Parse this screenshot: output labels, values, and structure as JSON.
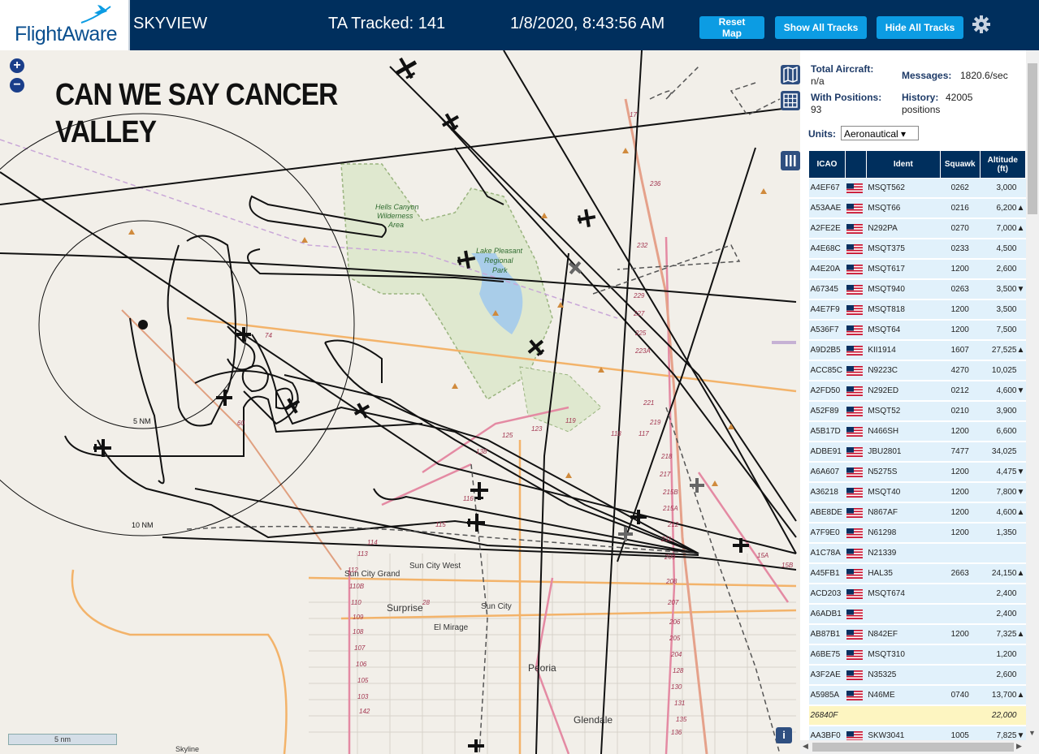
{
  "header": {
    "logo_text": "FlightAware",
    "app_title": "SKYVIEW",
    "tracked_label": "TA Tracked: 141",
    "datetime": "1/8/2020, 8:43:56 AM",
    "buttons": {
      "reset": "Reset Map",
      "show_all": "Show All Tracks",
      "hide_all": "Hide All Tracks"
    },
    "accent_color": "#0c9ce3",
    "bar_color": "#002f5d",
    "icons": [
      "gear-icon",
      "logo-plane-icon"
    ]
  },
  "map": {
    "overlay_line1": "CAN WE SAY CANCER",
    "overlay_line2": "VALLEY",
    "zoom_in": "+",
    "zoom_out": "−",
    "scale_label": "5 nm",
    "info_label": "i",
    "range_rings": [
      "5 NM",
      "10 NM"
    ],
    "places": [
      "Hells Canyon",
      "Wilderness",
      "Area",
      "Lake Pleasant",
      "Regional",
      "Park",
      "Sun City West",
      "Sun City Grand",
      "Surprise",
      "Sun City",
      "El Mirage",
      "Peoria",
      "Glendale",
      "Skyline"
    ],
    "road_labels": [
      "17",
      "74",
      "60",
      "236",
      "232",
      "229",
      "227",
      "225",
      "223A",
      "221",
      "219",
      "218",
      "217",
      "215B",
      "215A",
      "212",
      "211",
      "209",
      "208",
      "207",
      "206",
      "205",
      "204",
      "128",
      "130",
      "131",
      "135",
      "136",
      "138",
      "125",
      "123",
      "119",
      "118",
      "117",
      "116",
      "115",
      "114",
      "113",
      "112",
      "110B",
      "110",
      "109",
      "108",
      "107",
      "106",
      "105",
      "103",
      "142",
      "28",
      "15A",
      "15B"
    ],
    "tools": [
      "map-layers-icon",
      "grid-icon",
      "columns-icon"
    ]
  },
  "panel": {
    "total_aircraft_label": "Total Aircraft:",
    "total_aircraft_value": "n/a",
    "messages_label": "Messages:",
    "messages_value": "1820.6/sec",
    "with_positions_label": "With Positions:",
    "with_positions_value": "93",
    "history_label": "History:",
    "history_value": "42005",
    "history_unit": "positions",
    "units_label": "Units:",
    "units_value": "Aeronautical ▾",
    "columns": {
      "icao": "ICAO",
      "ident": "Ident",
      "squawk": "Squawk",
      "altitude": "Altitude (ft)"
    },
    "rows": [
      {
        "icao": "A4EF67",
        "ident": "MSQT562",
        "squawk": "0262",
        "alt": "3,000",
        "trend": ""
      },
      {
        "icao": "A53AAE",
        "ident": "MSQT66",
        "squawk": "0216",
        "alt": "6,200",
        "trend": "▲"
      },
      {
        "icao": "A2FE2E",
        "ident": "N292PA",
        "squawk": "0270",
        "alt": "7,000",
        "trend": "▲"
      },
      {
        "icao": "A4E68C",
        "ident": "MSQT375",
        "squawk": "0233",
        "alt": "4,500",
        "trend": ""
      },
      {
        "icao": "A4E20A",
        "ident": "MSQT617",
        "squawk": "1200",
        "alt": "2,600",
        "trend": ""
      },
      {
        "icao": "A67345",
        "ident": "MSQT940",
        "squawk": "0263",
        "alt": "3,500",
        "trend": "▼"
      },
      {
        "icao": "A4E7F9",
        "ident": "MSQT818",
        "squawk": "1200",
        "alt": "3,500",
        "trend": ""
      },
      {
        "icao": "A536F7",
        "ident": "MSQT64",
        "squawk": "1200",
        "alt": "7,500",
        "trend": ""
      },
      {
        "icao": "A9D2B5",
        "ident": "KII1914",
        "squawk": "1607",
        "alt": "27,525",
        "trend": "▲"
      },
      {
        "icao": "ACC85C",
        "ident": "N9223C",
        "squawk": "4270",
        "alt": "10,025",
        "trend": ""
      },
      {
        "icao": "A2FD50",
        "ident": "N292ED",
        "squawk": "0212",
        "alt": "4,600",
        "trend": "▼"
      },
      {
        "icao": "A52F89",
        "ident": "MSQT52",
        "squawk": "0210",
        "alt": "3,900",
        "trend": ""
      },
      {
        "icao": "A5B17D",
        "ident": "N466SH",
        "squawk": "1200",
        "alt": "6,600",
        "trend": ""
      },
      {
        "icao": "ADBE91",
        "ident": "JBU2801",
        "squawk": "7477",
        "alt": "34,025",
        "trend": ""
      },
      {
        "icao": "A6A607",
        "ident": "N5275S",
        "squawk": "1200",
        "alt": "4,475",
        "trend": "▼"
      },
      {
        "icao": "A36218",
        "ident": "MSQT40",
        "squawk": "1200",
        "alt": "7,800",
        "trend": "▼"
      },
      {
        "icao": "ABE8DE",
        "ident": "N867AF",
        "squawk": "1200",
        "alt": "4,600",
        "trend": "▲"
      },
      {
        "icao": "A7F9E0",
        "ident": "N61298",
        "squawk": "1200",
        "alt": "1,350",
        "trend": ""
      },
      {
        "icao": "A1C78A",
        "ident": "N21339",
        "squawk": "",
        "alt": "",
        "trend": ""
      },
      {
        "icao": "A45FB1",
        "ident": "HAL35",
        "squawk": "2663",
        "alt": "24,150",
        "trend": "▲"
      },
      {
        "icao": "ACD203",
        "ident": "MSQT674",
        "squawk": "",
        "alt": "2,400",
        "trend": ""
      },
      {
        "icao": "A6ADB1",
        "ident": "",
        "squawk": "",
        "alt": "2,400",
        "trend": ""
      },
      {
        "icao": "AB87B1",
        "ident": "N842EF",
        "squawk": "1200",
        "alt": "7,325",
        "trend": "▲"
      },
      {
        "icao": "A6BE75",
        "ident": "MSQT310",
        "squawk": "",
        "alt": "1,200",
        "trend": ""
      },
      {
        "icao": "A3F2AE",
        "ident": "N35325",
        "squawk": "",
        "alt": "2,600",
        "trend": ""
      },
      {
        "icao": "A5985A",
        "ident": "N46ME",
        "squawk": "0740",
        "alt": "13,700",
        "trend": "▲"
      },
      {
        "icao": "26840F",
        "ident": "",
        "squawk": "",
        "alt": "22,000",
        "trend": "",
        "highlight": true
      },
      {
        "icao": "AA3BF0",
        "ident": "SKW3041",
        "squawk": "1005",
        "alt": "7,825",
        "trend": "▼"
      }
    ],
    "scroll_arrows": {
      "left": "◀",
      "right": "▶",
      "down": "▼"
    }
  }
}
